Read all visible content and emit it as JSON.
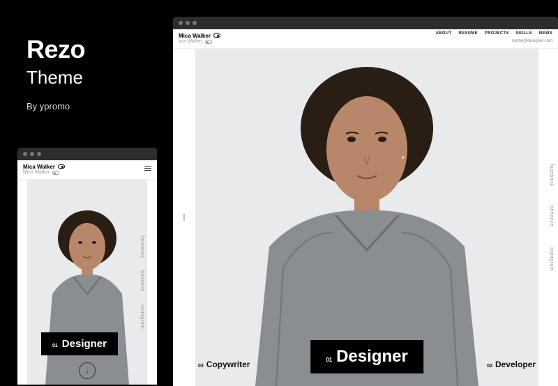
{
  "theme": {
    "name": "Rezo",
    "subtitle": "Theme",
    "author": "By ypromo"
  },
  "site": {
    "logo_primary": "Mica Walker",
    "logo_secondary": "lica Walker",
    "logo_mobile_secondary": "Mica Walker",
    "email": "martin@designer.com",
    "nav": {
      "about": "ABOUT",
      "resume": "RESUME",
      "projects": "PROJECTS",
      "skills": "SKILLS",
      "news": "NEWS"
    },
    "roles": {
      "main_num": "01",
      "main_label": "Designer",
      "left_num": "03",
      "left_label": "Copywriter",
      "right_num": "02",
      "right_label": "Developer"
    },
    "social": {
      "facebook": "facebook",
      "behance": "behance",
      "instagram": "instagram"
    },
    "scroll_arrow": "↓"
  }
}
